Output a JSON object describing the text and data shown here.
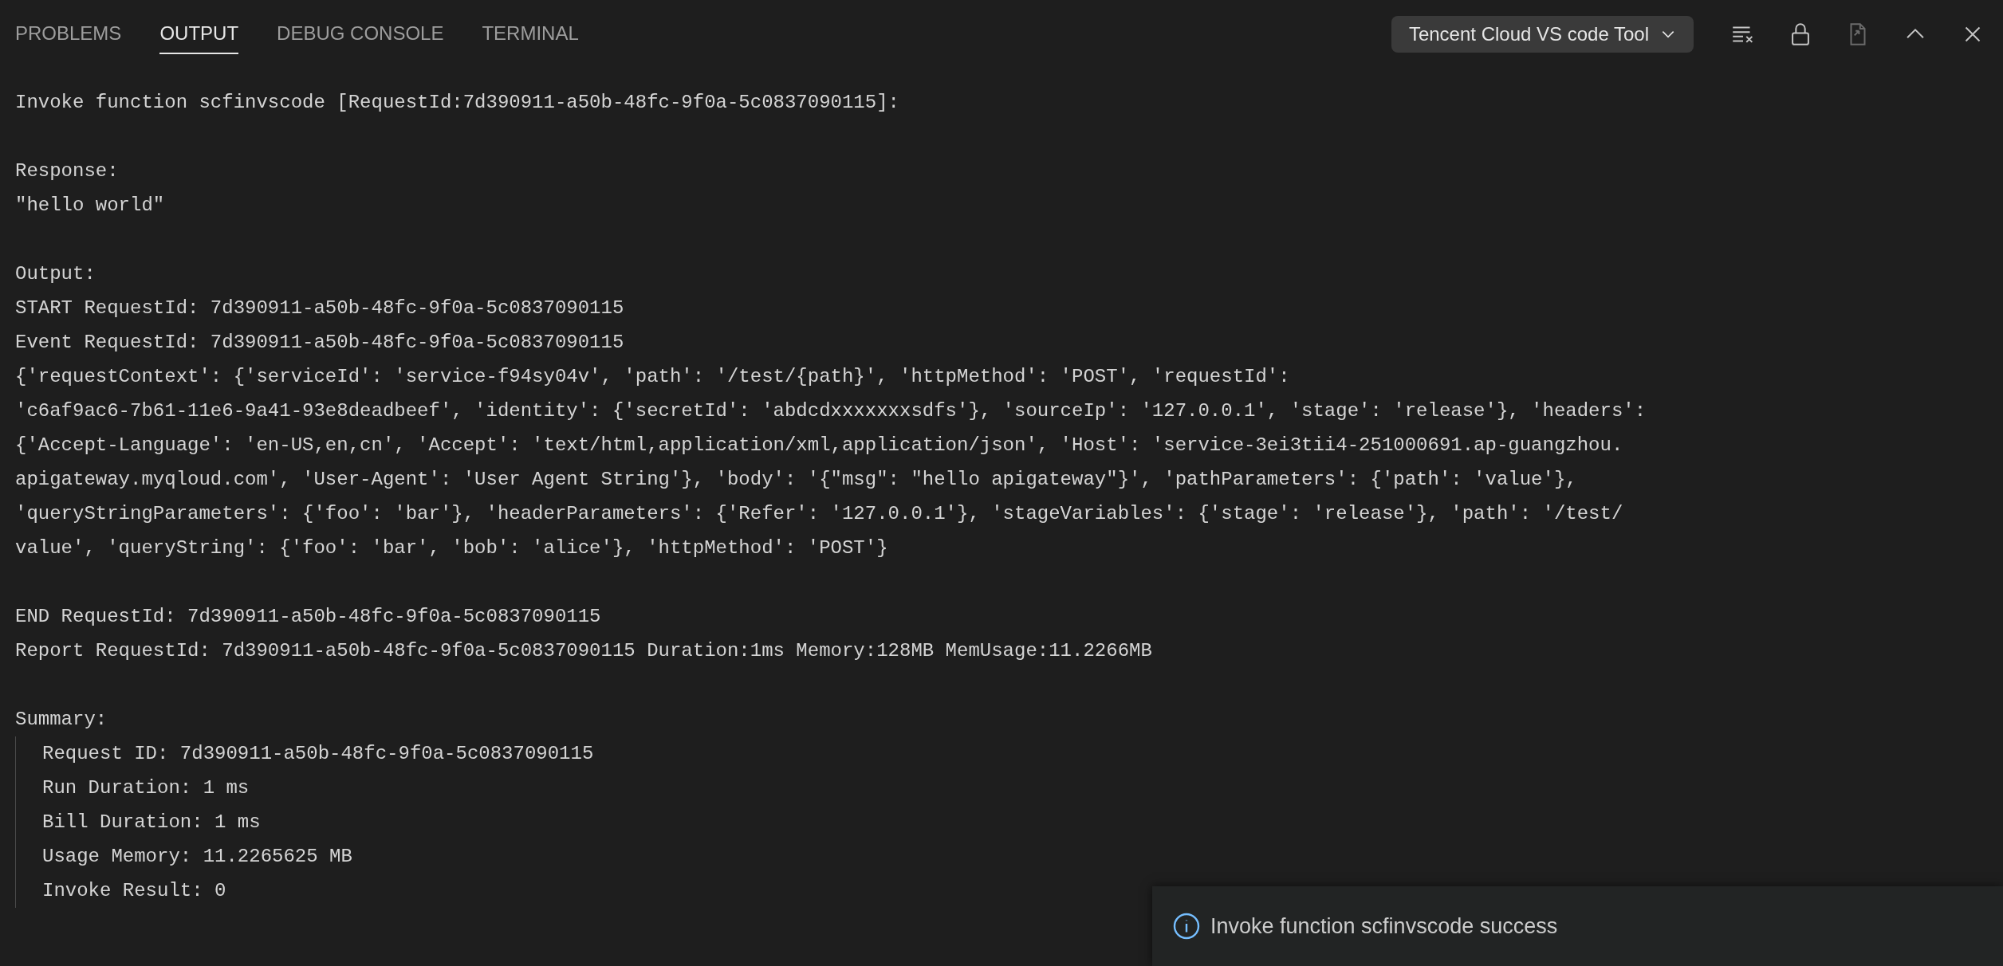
{
  "tabs": [
    {
      "label": "PROBLEMS",
      "selected": false
    },
    {
      "label": "OUTPUT",
      "selected": true
    },
    {
      "label": "DEBUG CONSOLE",
      "selected": false
    },
    {
      "label": "TERMINAL",
      "selected": false
    }
  ],
  "channel_select": {
    "value": "Tencent Cloud VS code Tool"
  },
  "toolbar": [
    {
      "kind": "clear",
      "disabled": false
    },
    {
      "kind": "lock",
      "disabled": false
    },
    {
      "kind": "open",
      "disabled": true
    },
    {
      "kind": "up",
      "disabled": false
    },
    {
      "kind": "close",
      "disabled": false
    }
  ],
  "output": {
    "blocks": [
      {
        "lines": [
          "Invoke function scfinvscode [RequestId:7d390911-a50b-48fc-9f0a-5c0837090115]:"
        ]
      },
      {
        "lines": [
          "Response:",
          "\"hello world\""
        ]
      },
      {
        "lines": [
          "Output:",
          "START RequestId: 7d390911-a50b-48fc-9f0a-5c0837090115",
          "Event RequestId: 7d390911-a50b-48fc-9f0a-5c0837090115",
          "{'requestContext': {'serviceId': 'service-f94sy04v', 'path': '/test/{path}', 'httpMethod': 'POST', 'requestId':",
          "'c6af9ac6-7b61-11e6-9a41-93e8deadbeef', 'identity': {'secretId': 'abdcdxxxxxxxsdfs'}, 'sourceIp': '127.0.0.1', 'stage': 'release'}, 'headers':",
          "{'Accept-Language': 'en-US,en,cn', 'Accept': 'text/html,application/xml,application/json', 'Host': 'service-3ei3tii4-251000691.ap-guangzhou.",
          "apigateway.myqloud.com', 'User-Agent': 'User Agent String'}, 'body': '{\"msg\": \"hello apigateway\"}', 'pathParameters': {'path': 'value'},",
          "'queryStringParameters': {'foo': 'bar'}, 'headerParameters': {'Refer': '127.0.0.1'}, 'stageVariables': {'stage': 'release'}, 'path': '/test/",
          "value', 'queryString': {'foo': 'bar', 'bob': 'alice'}, 'httpMethod': 'POST'}"
        ]
      },
      {
        "lines": [
          "END RequestId: 7d390911-a50b-48fc-9f0a-5c0837090115",
          "Report RequestId: 7d390911-a50b-48fc-9f0a-5c0837090115 Duration:1ms Memory:128MB MemUsage:11.2266MB"
        ]
      }
    ],
    "summary": {
      "title": "Summary:",
      "lines": [
        "Request ID: 7d390911-a50b-48fc-9f0a-5c0837090115",
        "Run Duration: 1 ms",
        "Bill Duration: 1 ms",
        "Usage Memory: 11.2265625 MB",
        "Invoke Result: 0"
      ]
    }
  },
  "notification": {
    "message": "Invoke function scfinvscode success"
  }
}
